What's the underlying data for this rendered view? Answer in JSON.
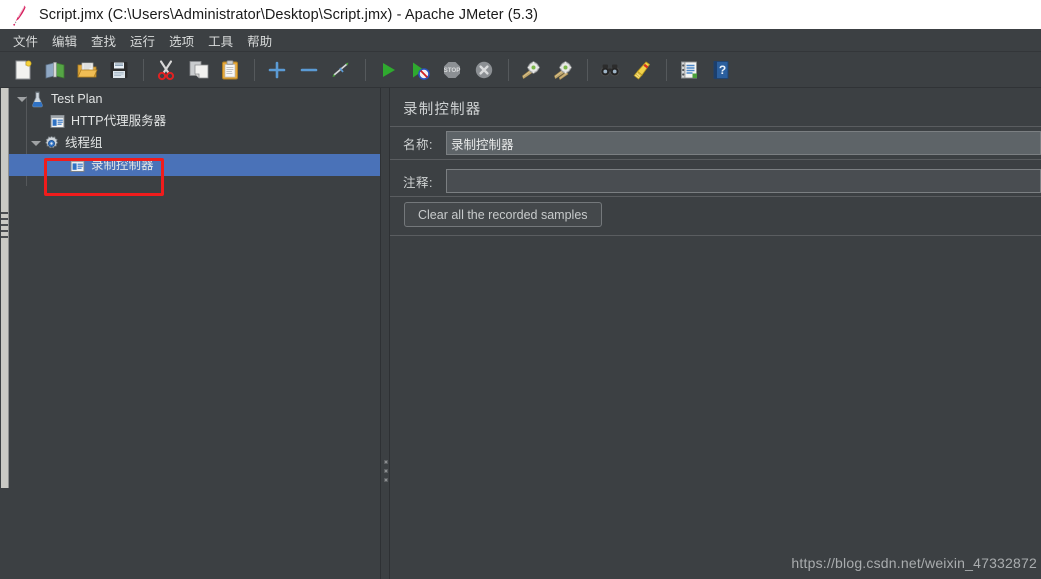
{
  "window": {
    "title": "Script.jmx (C:\\Users\\Administrator\\Desktop\\Script.jmx) - Apache JMeter (5.3)",
    "logo_icon": "jmeter-feather-icon"
  },
  "menubar": {
    "items": [
      {
        "label": "文件",
        "name": "menu-file"
      },
      {
        "label": "编辑",
        "name": "menu-edit"
      },
      {
        "label": "查找",
        "name": "menu-search"
      },
      {
        "label": "运行",
        "name": "menu-run"
      },
      {
        "label": "选项",
        "name": "menu-options"
      },
      {
        "label": "工具",
        "name": "menu-tools"
      },
      {
        "label": "帮助",
        "name": "menu-help"
      }
    ]
  },
  "toolbar": {
    "groups": [
      [
        {
          "icon": "new-document-icon",
          "name": "toolbar-new"
        },
        {
          "icon": "templates-icon",
          "name": "toolbar-templates"
        },
        {
          "icon": "open-folder-icon",
          "name": "toolbar-open"
        },
        {
          "icon": "save-floppy-icon",
          "name": "toolbar-save"
        }
      ],
      [
        {
          "icon": "scissors-cut-icon",
          "name": "toolbar-cut"
        },
        {
          "icon": "copy-icon",
          "name": "toolbar-copy"
        },
        {
          "icon": "clipboard-paste-icon",
          "name": "toolbar-paste"
        }
      ],
      [
        {
          "icon": "plus-icon",
          "name": "toolbar-expand"
        },
        {
          "icon": "minus-icon",
          "name": "toolbar-collapse"
        },
        {
          "icon": "toggle-icon",
          "name": "toolbar-toggle"
        }
      ],
      [
        {
          "icon": "play-start-icon",
          "name": "toolbar-start"
        },
        {
          "icon": "play-no-timers-icon",
          "name": "toolbar-start-no-pauses"
        },
        {
          "icon": "stop-icon",
          "name": "toolbar-stop"
        },
        {
          "icon": "shutdown-icon",
          "name": "toolbar-shutdown"
        }
      ],
      [
        {
          "icon": "clear-broom-icon",
          "name": "toolbar-clear"
        },
        {
          "icon": "clear-all-broom-icon",
          "name": "toolbar-clear-all"
        }
      ],
      [
        {
          "icon": "binoculars-search-icon",
          "name": "toolbar-search"
        },
        {
          "icon": "reset-search-broom-icon",
          "name": "toolbar-reset-search"
        }
      ],
      [
        {
          "icon": "function-helper-icon",
          "name": "toolbar-function-helper"
        },
        {
          "icon": "help-book-icon",
          "name": "toolbar-help"
        }
      ]
    ]
  },
  "tree": {
    "nodes": [
      {
        "label": "Test Plan",
        "icon": "flask-icon",
        "indent": 0,
        "expanded": true,
        "selected": false,
        "name": "tree-node-test-plan"
      },
      {
        "label": "HTTP代理服务器",
        "icon": "window-icon",
        "indent": 1,
        "expanded": null,
        "selected": false,
        "name": "tree-node-http-proxy-server"
      },
      {
        "label": "线程组",
        "icon": "gear-icon",
        "indent": 1,
        "expanded": true,
        "selected": false,
        "name": "tree-node-thread-group"
      },
      {
        "label": "录制控制器",
        "icon": "window-icon",
        "indent": 2,
        "expanded": null,
        "selected": true,
        "name": "tree-node-recording-controller"
      }
    ]
  },
  "annotation": {
    "highlight_color": "#f01c1c",
    "target": "录制控制器"
  },
  "right_panel": {
    "title": "录制控制器",
    "fields": [
      {
        "label": "名称:",
        "value": "录制控制器",
        "name": "name-field"
      },
      {
        "label": "注释:",
        "value": "",
        "name": "comment-field"
      }
    ],
    "button": {
      "label": "Clear all the recorded samples",
      "name": "clear-recorded-samples-button"
    }
  },
  "watermark": {
    "text": "https://blog.csdn.net/weixin_47332872"
  },
  "colors": {
    "app_bg": "#3c4043",
    "titlebar_bg": "#ffffff",
    "selection_blue": "#4a72b8",
    "field_filled_bg": "#5e6468",
    "field_empty_bg": "#494d51",
    "text": "#e2e4e4",
    "annotation_red": "#f01c1c"
  }
}
